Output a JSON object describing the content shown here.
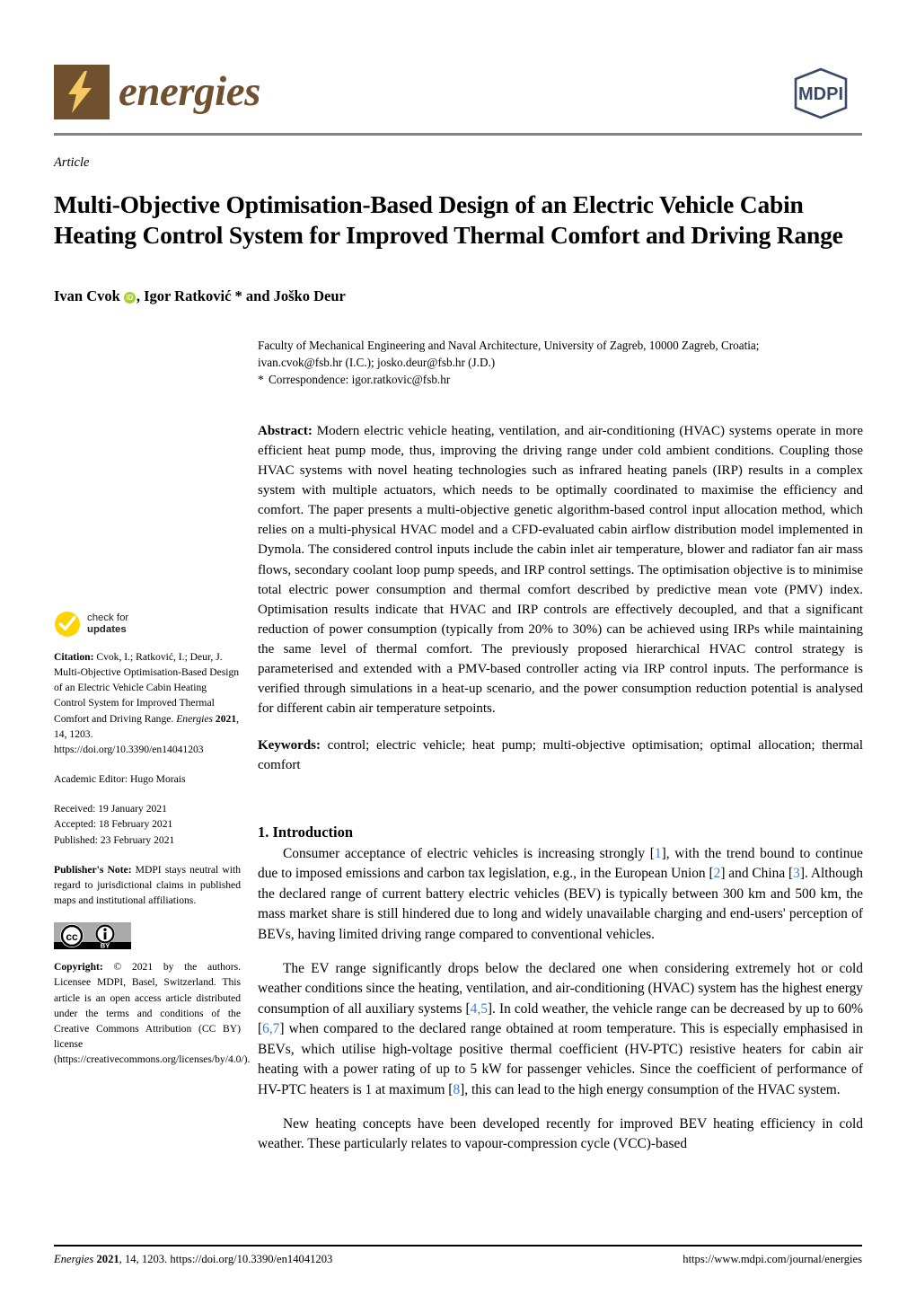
{
  "journal": {
    "name": "energies",
    "publisher_logo_text": "MDPI",
    "logo_icon": "lightning-bolt-icon",
    "brand_color": "#6f5130",
    "bolt_color": "#f5c863",
    "mdpi_color": "#394a68",
    "rule_color": "#808285"
  },
  "article": {
    "type_label": "Article",
    "title": "Multi-Objective Optimisation-Based Design of an Electric Vehicle Cabin Heating Control System for Improved Thermal Comfort and Driving Range",
    "authors_prefix": "Ivan Cvok",
    "authors_suffix": ", Igor Ratković * and Joško Deur",
    "orcid_label": "iD",
    "orcid_color": "#a6ce39"
  },
  "affiliation": {
    "line1": "Faculty of Mechanical Engineering and Naval Architecture, University of Zagreb, 10000 Zagreb, Croatia;",
    "line2": "ivan.cvok@fsb.hr (I.C.); josko.deur@fsb.hr (J.D.)",
    "corr_marker": "*",
    "corr_text": "Correspondence: igor.ratkovic@fsb.hr"
  },
  "abstract": {
    "label": "Abstract:",
    "text": " Modern electric vehicle heating, ventilation, and air-conditioning (HVAC) systems operate in more efficient heat pump mode, thus, improving the driving range under cold ambient conditions. Coupling those HVAC systems with novel heating technologies such as infrared heating panels (IRP) results in a complex system with multiple actuators, which needs to be optimally coordinated to maximise the efficiency and comfort. The paper presents a multi-objective genetic algorithm-based control input allocation method, which relies on a multi-physical HVAC model and a CFD-evaluated cabin airflow distribution model implemented in Dymola. The considered control inputs include the cabin inlet air temperature, blower and radiator fan air mass flows, secondary coolant loop pump speeds, and IRP control settings. The optimisation objective is to minimise total electric power consumption and thermal comfort described by predictive mean vote (PMV) index. Optimisation results indicate that HVAC and IRP controls are effectively decoupled, and that a significant reduction of power consumption (typically from 20% to 30%) can be achieved using IRPs while maintaining the same level of thermal comfort. The previously proposed hierarchical HVAC control strategy is parameterised and extended with a PMV-based controller acting via IRP control inputs. The performance is verified through simulations in a heat-up scenario, and the power consumption reduction potential is analysed for different cabin air temperature setpoints."
  },
  "keywords": {
    "label": "Keywords:",
    "text": " control; electric vehicle; heat pump; multi-objective optimisation; optimal allocation; thermal comfort"
  },
  "sidebar": {
    "check_updates": {
      "line1": "check for",
      "line2": "updates",
      "icon": "check-circle-icon",
      "color": "#ffd300"
    },
    "citation": {
      "label": "Citation:",
      "text": " Cvok, I.; Ratković, I.; Deur, J. Multi-Objective Optimisation-Based Design of an Electric Vehicle Cabin Heating Control System for Improved Thermal Comfort and Driving Range. ",
      "journal_italic": "Energies",
      "year_bold": "2021",
      "rest": ", 14, 1203. https://doi.org/10.3390/en14041203"
    },
    "academic_editor": "Academic Editor: Hugo Morais",
    "received": "Received: 19 January 2021",
    "accepted": "Accepted: 18 February 2021",
    "published": "Published: 23 February 2021",
    "publisher_note": {
      "label": "Publisher's Note:",
      "text": " MDPI stays neutral with regard to jurisdictional claims in published maps and institutional affiliations."
    },
    "license_badge": {
      "cc_label": "cc",
      "by_label": "BY",
      "icon": "creative-commons-icon"
    },
    "copyright": {
      "label": "Copyright:",
      "text": " © 2021 by the authors. Licensee MDPI, Basel, Switzerland. This article is an open access article distributed under the terms and conditions of the Creative Commons Attribution (CC BY) license (https://creativecommons.org/licenses/by/4.0/)."
    }
  },
  "introduction": {
    "heading": "1. Introduction",
    "p1_a": "Consumer acceptance of electric vehicles is increasing strongly [",
    "p1_c1": "1",
    "p1_b": "], with the trend bound to continue due to imposed emissions and carbon tax legislation, e.g., in the European Union [",
    "p1_c2": "2",
    "p1_c": "] and China [",
    "p1_c3": "3",
    "p1_d": "]. Although the declared range of current battery electric vehicles (BEV) is typically between 300 km and 500 km, the mass market share is still hindered due to long and widely unavailable charging and end-users' perception of BEVs, having limited driving range compared to conventional vehicles.",
    "p2_a": "The EV range significantly drops below the declared one when considering extremely hot or cold weather conditions since the heating, ventilation, and air-conditioning (HVAC) system has the highest energy consumption of all auxiliary systems [",
    "p2_c1": "4,5",
    "p2_b": "]. In cold weather, the vehicle range can be decreased by up to 60% [",
    "p2_c2": "6,7",
    "p2_c": "] when compared to the declared range obtained at room temperature. This is especially emphasised in BEVs, which utilise high-voltage positive thermal coefficient (HV-PTC) resistive heaters for cabin air heating with a power rating of up to 5 kW for passenger vehicles. Since the coefficient of performance of HV-PTC heaters is 1 at maximum [",
    "p2_c3": "8",
    "p2_d": "], this can lead to the high energy consumption of the HVAC system.",
    "p3": "New heating concepts have been developed recently for improved BEV heating efficiency in cold weather. These particularly relates to vapour-compression cycle (VCC)-based"
  },
  "footer": {
    "left_italic": "Energies",
    "left_bold": "2021",
    "left_rest": ", 14, 1203. https://doi.org/10.3390/en14041203",
    "right": "https://www.mdpi.com/journal/energies"
  }
}
